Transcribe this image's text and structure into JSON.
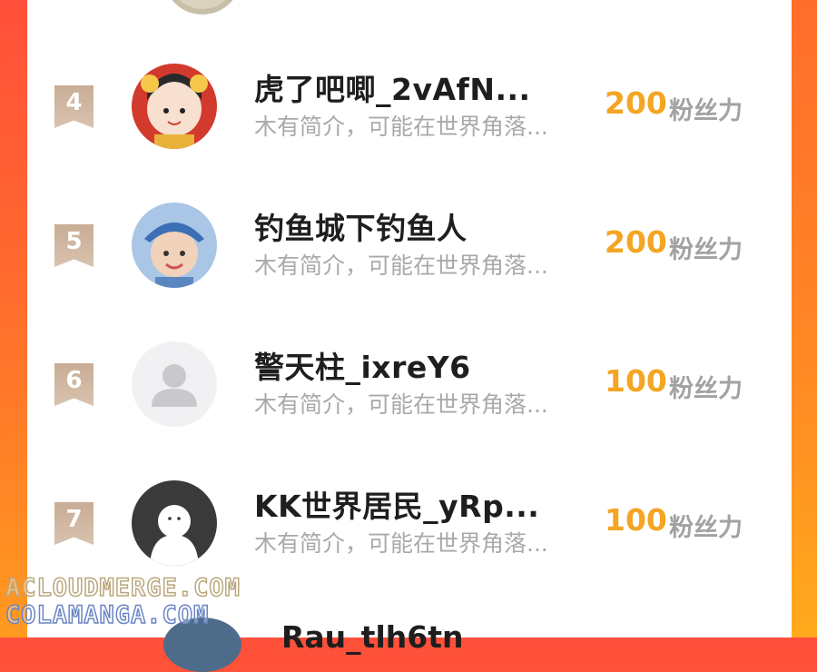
{
  "ranking": {
    "entries": [
      {
        "rank": "4",
        "name": "虎了吧唧_2vAfN...",
        "bio": "木有简介，可能在世界角落...",
        "score": "200",
        "unit": "粉丝力",
        "avatar": "avatar-cartoon-girl"
      },
      {
        "rank": "5",
        "name": "钓鱼城下钓鱼人",
        "bio": "木有简介，可能在世界角落...",
        "score": "200",
        "unit": "粉丝力",
        "avatar": "avatar-baby-photo"
      },
      {
        "rank": "6",
        "name": "警天柱_ixreY6",
        "bio": "木有简介，可能在世界角落...",
        "score": "100",
        "unit": "粉丝力",
        "avatar": "avatar-default-person"
      },
      {
        "rank": "7",
        "name": "KK世界居民_yRp...",
        "bio": "木有简介，可能在世界角落...",
        "score": "100",
        "unit": "粉丝力",
        "avatar": "avatar-ghost-icon"
      }
    ],
    "next_entry_partial_name": "Rau_tlh6tn"
  },
  "watermark": {
    "line1": "ACLOUDMERGE.COM",
    "line2": "COLAMANGA.COM"
  },
  "colors": {
    "score": "#f4a522",
    "rank_badge": "#d0b59e",
    "background_gradient_top": "#ff4f3a",
    "background_gradient_bottom": "#ff9a1f"
  }
}
